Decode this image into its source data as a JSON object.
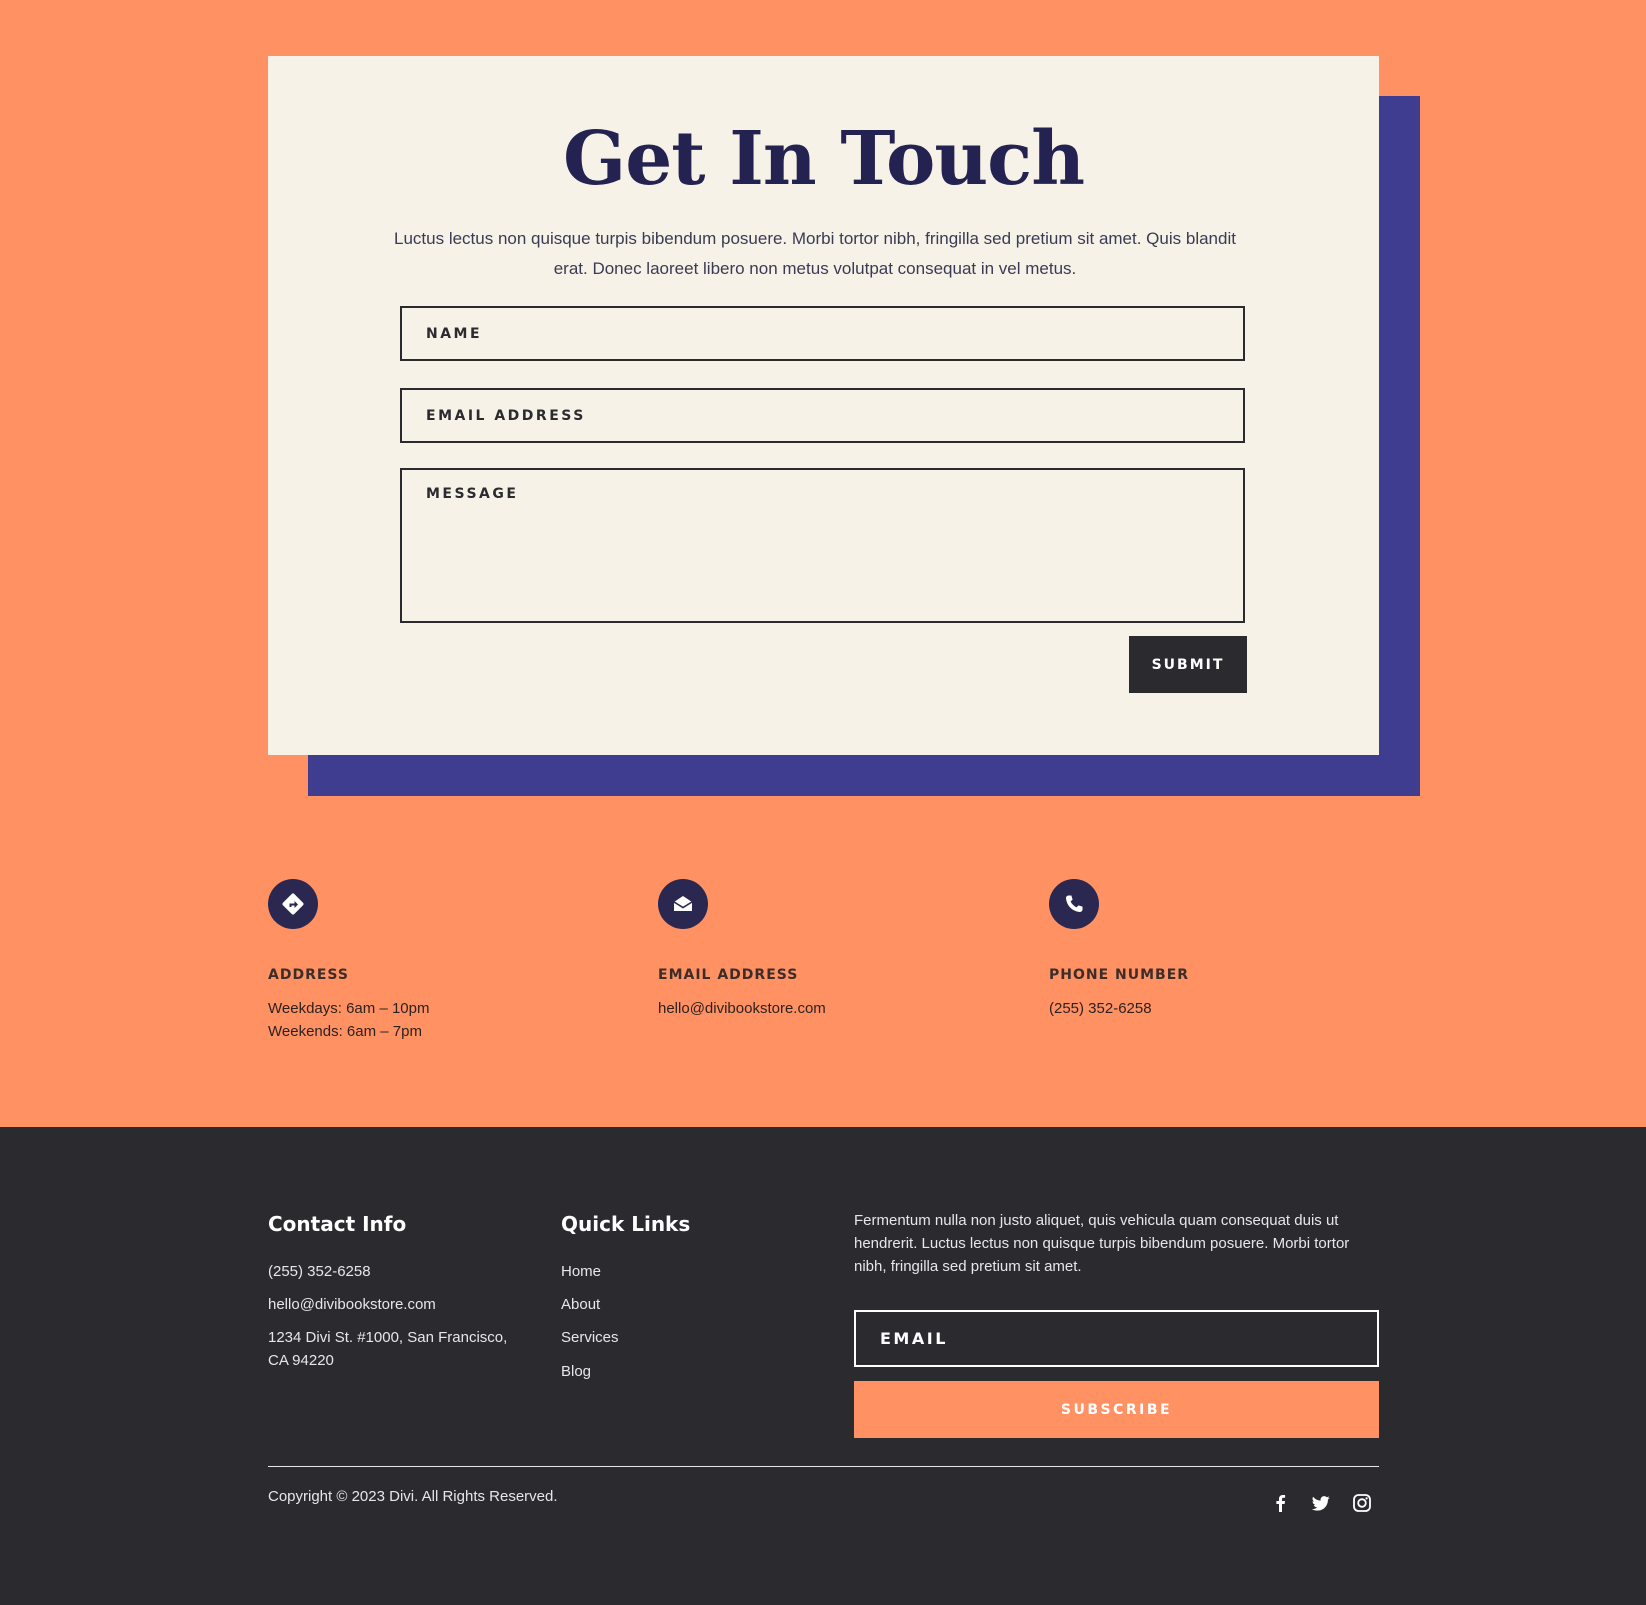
{
  "contact_form": {
    "title": "Get In Touch",
    "intro": "Luctus lectus non quisque turpis bibendum posuere. Morbi tortor nibh, fringilla sed pretium sit amet. Quis blandit erat. Donec laoreet libero non metus volutpat consequat in vel metus.",
    "name_placeholder": "NAME",
    "email_placeholder": "EMAIL ADDRESS",
    "message_placeholder": "MESSAGE",
    "submit_label": "SUBMIT"
  },
  "info": {
    "address": {
      "icon": "directions-icon",
      "label": "ADDRESS",
      "line1": "Weekdays: 6am – 10pm",
      "line2": "Weekends: 6am – 7pm"
    },
    "email": {
      "icon": "envelope-open-icon",
      "label": "EMAIL ADDRESS",
      "value": "hello@divibookstore.com"
    },
    "phone": {
      "icon": "phone-icon",
      "label": "PHONE NUMBER",
      "value": "(255) 352-6258"
    }
  },
  "footer": {
    "contact_heading": "Contact Info",
    "contact_phone": "(255) 352-6258",
    "contact_email": "hello@divibookstore.com",
    "contact_address_line1": "1234 Divi St. #1000, San Francisco,",
    "contact_address_line2": "CA 94220",
    "links_heading": "Quick Links",
    "links": [
      "Home",
      "About",
      "Services",
      "Blog"
    ],
    "newsletter_text": "Fermentum nulla non justo aliquet, quis vehicula quam consequat duis ut hendrerit. Luctus lectus non quisque turpis bibendum posuere. Morbi tortor nibh, fringilla sed pretium sit amet.",
    "email_placeholder": "EMAIL",
    "subscribe_label": "SUBSCRIBE",
    "copyright": "Copyright © 2023 Divi. All Rights Reserved.",
    "social": [
      "facebook-icon",
      "twitter-icon",
      "instagram-icon"
    ]
  },
  "colors": {
    "orange": "#ff9163",
    "navy": "#242250",
    "shadow_blue": "#3f3d8f",
    "cream": "#f6f2e8",
    "charcoal": "#2b2a2f"
  }
}
